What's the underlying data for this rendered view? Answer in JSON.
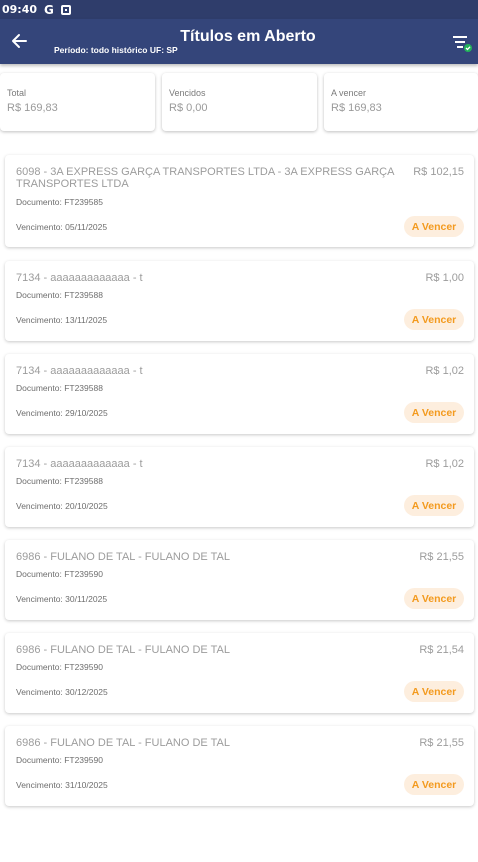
{
  "status_bar": {
    "time": "09:40",
    "google_letter": "G"
  },
  "header": {
    "title": "Títulos em Aberto",
    "subtitle": "Período: todo histórico UF: SP"
  },
  "summary": [
    {
      "label": "Total",
      "value": "R$ 169,83"
    },
    {
      "label": "Vencidos",
      "value": "R$ 0,00"
    },
    {
      "label": "A vencer",
      "value": "R$ 169,83"
    }
  ],
  "titles": [
    {
      "name": "6098   - 3A EXPRESS GARÇA TRANSPORTES LTDA - 3A EXPRESS GARÇA TRANSPORTES LTDA",
      "amount": "R$ 102,15",
      "document": "Documento: FT239585",
      "due": "Vencimento: 05/11/2025",
      "status": "A Vencer"
    },
    {
      "name": "7134   - aaaaaaaaaaaaa - t",
      "amount": "R$ 1,00",
      "document": "Documento: FT239588",
      "due": "Vencimento: 13/11/2025",
      "status": "A Vencer"
    },
    {
      "name": "7134   - aaaaaaaaaaaaa - t",
      "amount": "R$ 1,02",
      "document": "Documento: FT239588",
      "due": "Vencimento: 29/10/2025",
      "status": "A Vencer"
    },
    {
      "name": "7134   - aaaaaaaaaaaaa - t",
      "amount": "R$ 1,02",
      "document": "Documento: FT239588",
      "due": "Vencimento: 20/10/2025",
      "status": "A Vencer"
    },
    {
      "name": "6986   - FULANO DE TAL - FULANO DE TAL",
      "amount": "R$ 21,55",
      "document": "Documento: FT239590",
      "due": "Vencimento: 30/11/2025",
      "status": "A Vencer"
    },
    {
      "name": "6986   - FULANO DE TAL - FULANO DE TAL",
      "amount": "R$ 21,54",
      "document": "Documento: FT239590",
      "due": "Vencimento: 30/12/2025",
      "status": "A Vencer"
    },
    {
      "name": "6986   - FULANO DE TAL - FULANO DE TAL",
      "amount": "R$ 21,55",
      "document": "Documento: FT239590",
      "due": "Vencimento: 31/10/2025",
      "status": "A Vencer"
    }
  ],
  "icons": {
    "back": "arrow-left-icon",
    "filter": "filter-check-icon",
    "notification": "notification-square-icon"
  },
  "colors": {
    "app_bar": "#34457a",
    "status_bar": "#2f3d6b",
    "badge_text": "#f39a1e",
    "badge_bg": "#fdeede",
    "filter_check": "#22b35a"
  }
}
